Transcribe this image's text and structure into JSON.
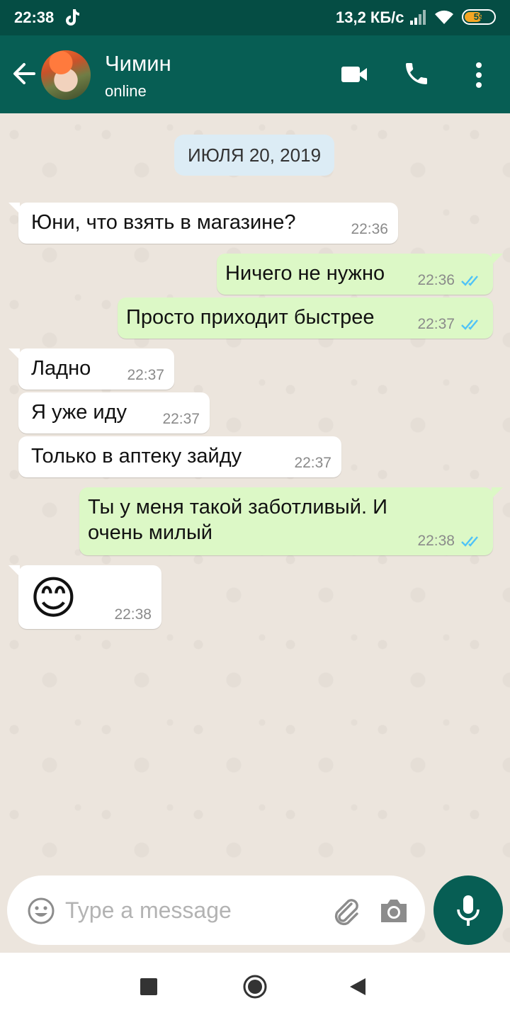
{
  "status_bar": {
    "time": "22:38",
    "network_speed": "13,2 КБ/с",
    "battery_level": "59",
    "battery_fraction": 0.59,
    "icons": [
      "tiktok-icon",
      "signal-icon",
      "wifi-icon",
      "battery-icon"
    ]
  },
  "header": {
    "contact_name": "Чимин",
    "contact_status": "online",
    "icons": [
      "back-arrow-icon",
      "video-call-icon",
      "phone-icon",
      "more-vert-icon"
    ],
    "colors": {
      "header": "#075e54",
      "statusbar": "#054d44"
    }
  },
  "chat": {
    "date_label": "ИЮЛЯ 20, 2019",
    "messages": [
      {
        "direction": "in",
        "text": "Юни, что взять в магазине?",
        "time": "22:36"
      },
      {
        "direction": "out",
        "text": "Ничего не нужно",
        "time": "22:36",
        "read": true
      },
      {
        "direction": "out",
        "text": "Просто приходит быстрее",
        "time": "22:37",
        "read": true
      },
      {
        "direction": "in",
        "text": "Ладно",
        "time": "22:37"
      },
      {
        "direction": "in",
        "text": "Я уже иду",
        "time": "22:37"
      },
      {
        "direction": "in",
        "text": "Только в аптеку зайду",
        "time": "22:37"
      },
      {
        "direction": "out",
        "text": "Ты у меня такой заботливый. И\nочень милый",
        "time": "22:38",
        "read": true
      },
      {
        "direction": "in",
        "text": "😊",
        "time": "22:38"
      }
    ],
    "colors": {
      "incoming": "#ffffff",
      "outgoing": "#dcf8c6",
      "read_ticks": "#4fc3f7",
      "background": "#ece5dd"
    }
  },
  "composer": {
    "placeholder": "Type a message",
    "icons": [
      "emoji-icon",
      "attach-icon",
      "camera-icon",
      "mic-icon"
    ]
  },
  "navigation": {
    "icons": [
      "recents-square-icon",
      "home-circle-icon",
      "back-triangle-icon"
    ]
  }
}
